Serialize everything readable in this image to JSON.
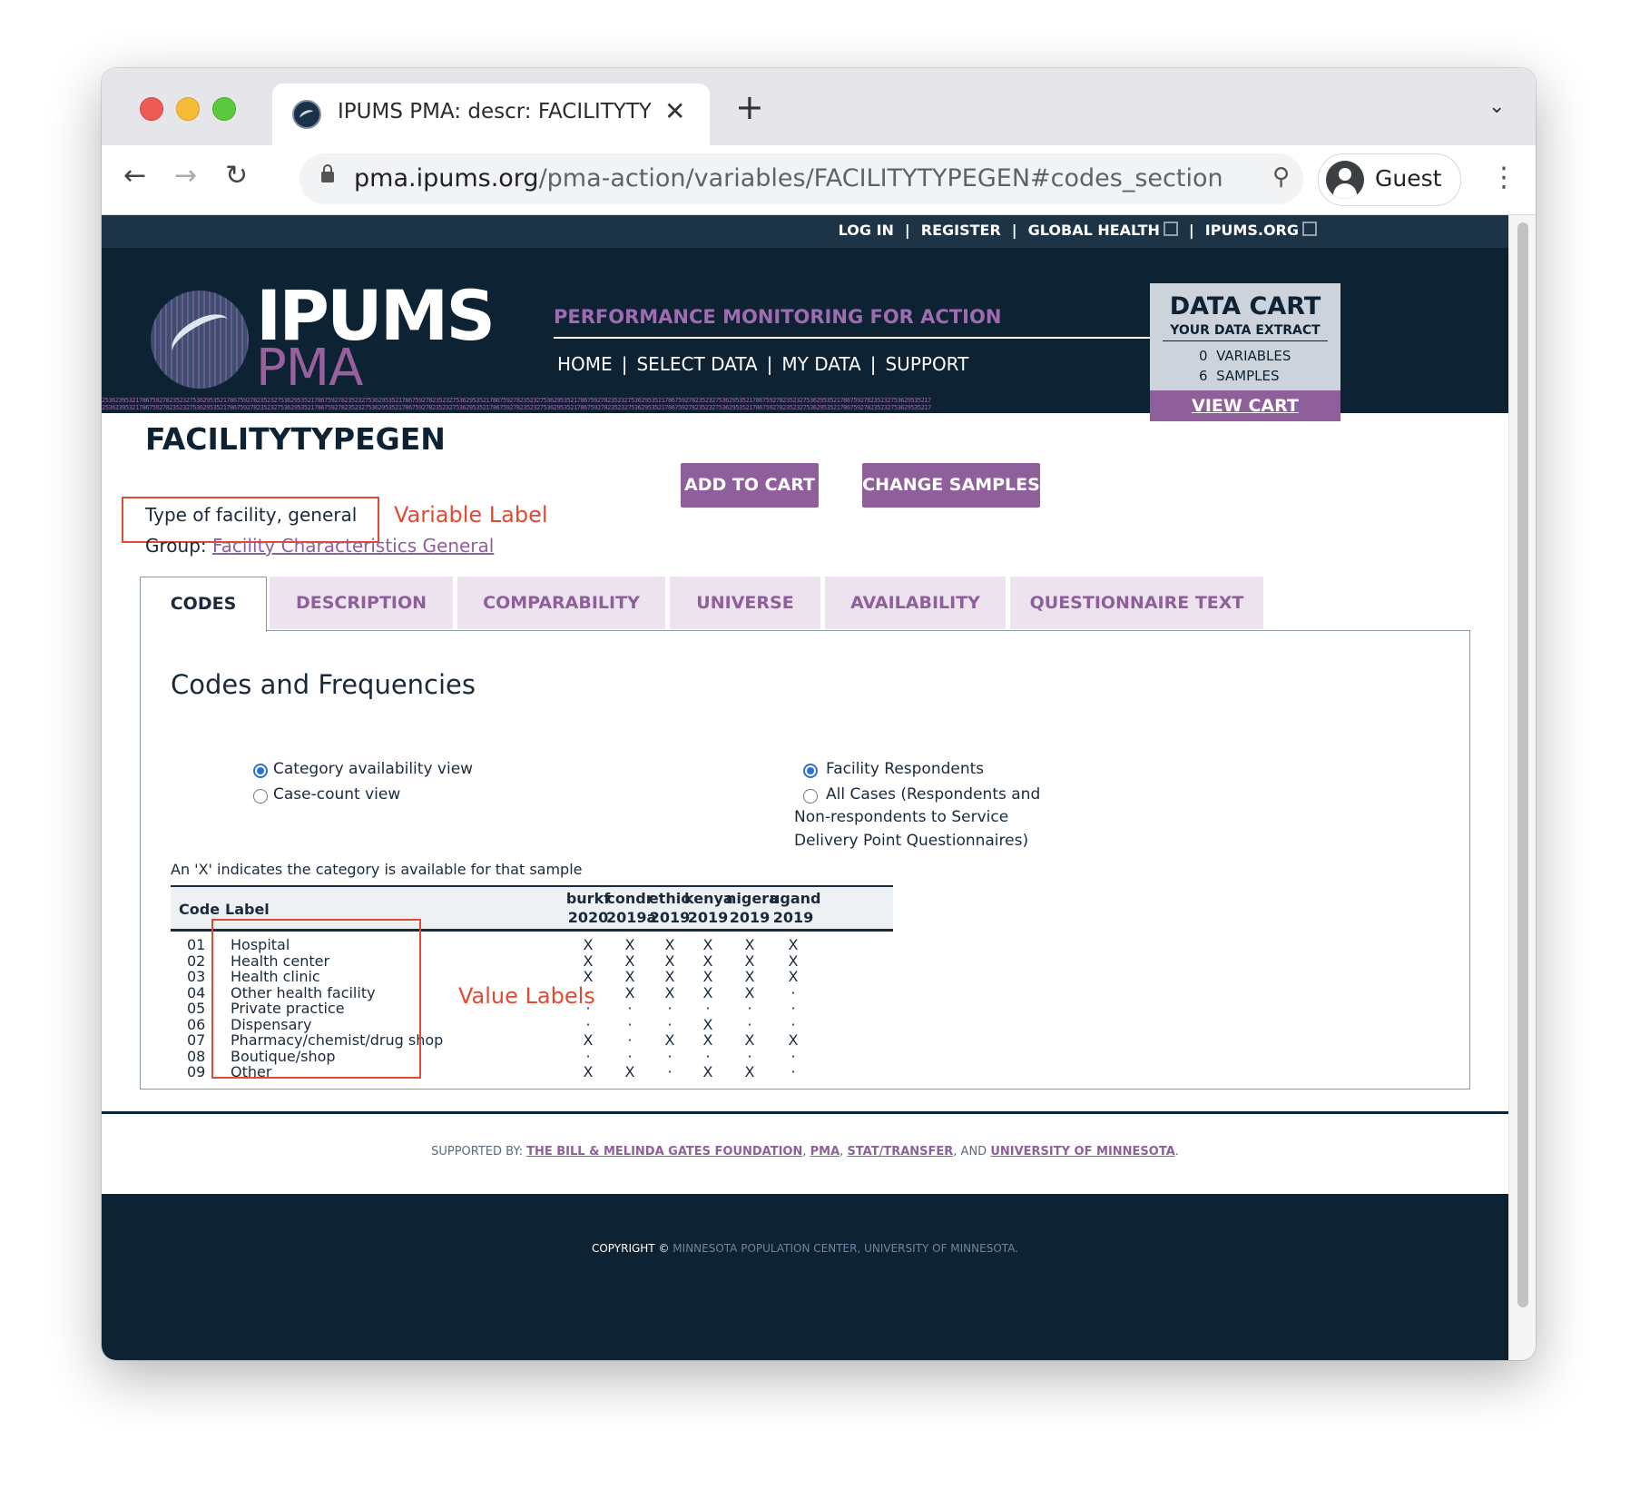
{
  "browser": {
    "tab_title": "IPUMS PMA: descr: FACILITYTYPEGEN",
    "close_glyph": "✕",
    "newtab_glyph": "+",
    "url_host": "pma.ipums.org",
    "url_path": "/pma-action/variables/FACILITYTYPEGEN#codes_section",
    "profile_label": "Guest"
  },
  "toplinks": {
    "login": "LOG IN",
    "register": "REGISTER",
    "global_health": "GLOBAL HEALTH",
    "ipums_org": "IPUMS.ORG",
    "sep": "|"
  },
  "logo": {
    "ipums": "IPUMS",
    "pma": "PMA"
  },
  "header": {
    "tagline": "PERFORMANCE MONITORING FOR ACTION"
  },
  "nav": {
    "home": "HOME",
    "select_data": "SELECT DATA",
    "my_data": "MY DATA",
    "support": "SUPPORT",
    "sep": "|"
  },
  "cart": {
    "title": "DATA CART",
    "subtitle": "YOUR DATA EXTRACT",
    "variables_count": "0",
    "variables_label": "VARIABLES",
    "samples_count": "6",
    "samples_label": "SAMPLES",
    "view_label": "VIEW CART"
  },
  "digits": "253623953217867592782352327536295352178675927823523275362953521786759278235232753629535217867592782352327536295352178675927823523275362953521786759278235232753629535217867592782352327536295352178675927823523275362953521786759278235232753629535217",
  "variable": {
    "name": "FACILITYTYPEGEN",
    "label": "Type of facility, general",
    "group_prefix": "Group:",
    "group_link": "Facility Characteristics General"
  },
  "buttons": {
    "add_to_cart": "ADD TO CART",
    "change_samples": "CHANGE SAMPLES"
  },
  "annotations": {
    "variable_label": "Variable Label",
    "value_labels": "Value Labels"
  },
  "tabs": [
    "CODES",
    "DESCRIPTION",
    "COMPARABILITY",
    "UNIVERSE",
    "AVAILABILITY",
    "QUESTIONNAIRE TEXT"
  ],
  "codes": {
    "heading": "Codes and Frequencies",
    "view_options": [
      "Category availability view",
      "Case-count view"
    ],
    "case_options": [
      "Facility Respondents",
      "All Cases (Respondents and",
      "Non-respondents to Service",
      "Delivery Point Questionnaires)"
    ],
    "note": "An 'X' indicates the category is available for that sample",
    "col_code": "Code",
    "col_label": "Label",
    "samples": [
      {
        "top": "burkf",
        "bottom": "2020"
      },
      {
        "top": "condr",
        "bottom": "2019a"
      },
      {
        "top": "ethio",
        "bottom": "2019"
      },
      {
        "top": "kenya",
        "bottom": "2019"
      },
      {
        "top": "nigera",
        "bottom": "2019"
      },
      {
        "top": "ugand",
        "bottom": "2019"
      }
    ],
    "rows": [
      {
        "code": "01",
        "label": "Hospital",
        "vals": [
          "X",
          "X",
          "X",
          "X",
          "X",
          "X"
        ]
      },
      {
        "code": "02",
        "label": "Health center",
        "vals": [
          "X",
          "X",
          "X",
          "X",
          "X",
          "X"
        ]
      },
      {
        "code": "03",
        "label": "Health clinic",
        "vals": [
          "X",
          "X",
          "X",
          "X",
          "X",
          "X"
        ]
      },
      {
        "code": "04",
        "label": "Other health facility",
        "vals": [
          "·",
          "X",
          "X",
          "X",
          "X",
          "·"
        ]
      },
      {
        "code": "05",
        "label": "Private practice",
        "vals": [
          "·",
          "·",
          "·",
          "·",
          "·",
          "·"
        ]
      },
      {
        "code": "06",
        "label": "Dispensary",
        "vals": [
          "·",
          "·",
          "·",
          "X",
          "·",
          "·"
        ]
      },
      {
        "code": "07",
        "label": "Pharmacy/chemist/drug shop",
        "vals": [
          "X",
          "·",
          "X",
          "X",
          "X",
          "X"
        ]
      },
      {
        "code": "08",
        "label": "Boutique/shop",
        "vals": [
          "·",
          "·",
          "·",
          "·",
          "·",
          "·"
        ]
      },
      {
        "code": "09",
        "label": "Other",
        "vals": [
          "X",
          "X",
          "·",
          "X",
          "X",
          "·"
        ]
      }
    ]
  },
  "footer": {
    "supported_by": "SUPPORTED BY:",
    "gates": "THE BILL & MELINDA GATES FOUNDATION",
    "pma": "PMA",
    "stat": "STAT/TRANSFER",
    "and": ", AND",
    "umn": "UNIVERSITY OF MINNESOTA",
    "copyright_prefix": "COPYRIGHT ©",
    "copyright_org": "MINNESOTA POPULATION CENTER, UNIVERSITY OF MINNESOTA."
  },
  "colors": {
    "accent": "#8f5f9c",
    "navy": "#0d2233",
    "annotation": "#e24a32"
  }
}
